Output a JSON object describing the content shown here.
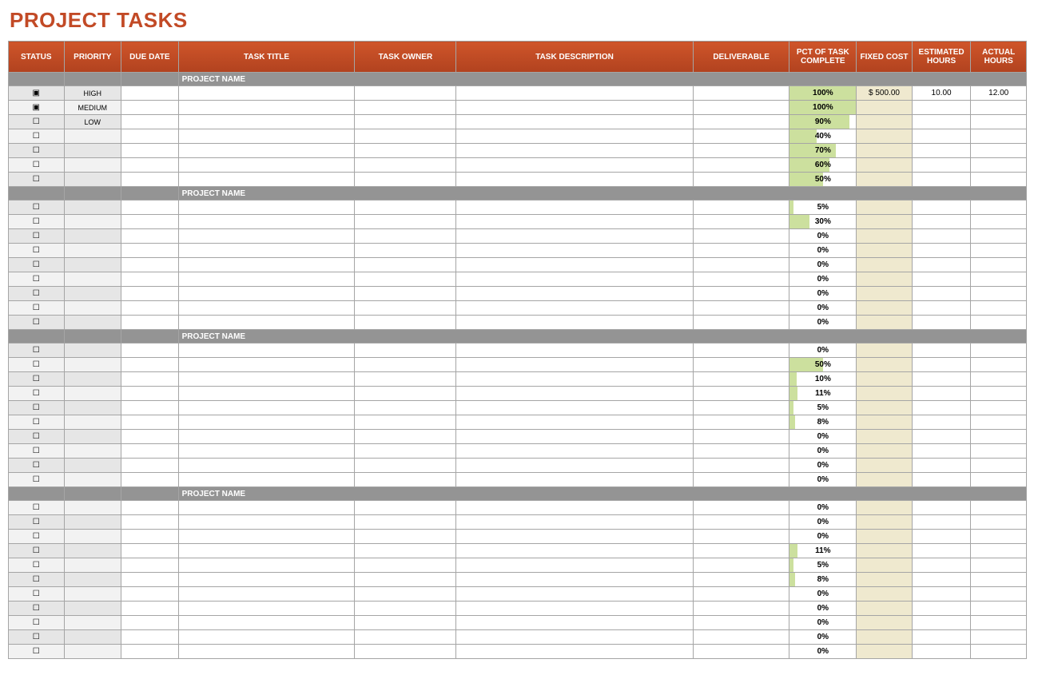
{
  "title": "PROJECT TASKS",
  "columns": [
    "STATUS",
    "PRIORITY",
    "DUE DATE",
    "TASK TITLE",
    "TASK OWNER",
    "TASK DESCRIPTION",
    "DELIVERABLE",
    "PCT OF TASK COMPLETE",
    "FIXED COST",
    "ESTIMATED HOURS",
    "ACTUAL HOURS"
  ],
  "section_label": "PROJECT NAME",
  "checkbox": {
    "checked": "▣",
    "unchecked": "☐"
  },
  "sections": [
    {
      "rows": [
        {
          "status": true,
          "priority": "HIGH",
          "pct": 100,
          "fixed_cost": "$      500.00",
          "est": "10.00",
          "act": "12.00"
        },
        {
          "status": true,
          "priority": "MEDIUM",
          "pct": 100
        },
        {
          "status": false,
          "priority": "LOW",
          "pct": 90
        },
        {
          "status": false,
          "pct": 40
        },
        {
          "status": false,
          "pct": 70
        },
        {
          "status": false,
          "pct": 60
        },
        {
          "status": false,
          "pct": 50
        }
      ]
    },
    {
      "rows": [
        {
          "status": false,
          "pct": 5
        },
        {
          "status": false,
          "pct": 30
        },
        {
          "status": false,
          "pct": 0
        },
        {
          "status": false,
          "pct": 0
        },
        {
          "status": false,
          "pct": 0
        },
        {
          "status": false,
          "pct": 0
        },
        {
          "status": false,
          "pct": 0
        },
        {
          "status": false,
          "pct": 0
        },
        {
          "status": false,
          "pct": 0
        }
      ]
    },
    {
      "rows": [
        {
          "status": false,
          "pct": 0
        },
        {
          "status": false,
          "pct": 50
        },
        {
          "status": false,
          "pct": 10
        },
        {
          "status": false,
          "pct": 11
        },
        {
          "status": false,
          "pct": 5
        },
        {
          "status": false,
          "pct": 8
        },
        {
          "status": false,
          "pct": 0
        },
        {
          "status": false,
          "pct": 0
        },
        {
          "status": false,
          "pct": 0
        },
        {
          "status": false,
          "pct": 0
        }
      ]
    },
    {
      "rows": [
        {
          "status": false,
          "pct": 0
        },
        {
          "status": false,
          "pct": 0
        },
        {
          "status": false,
          "pct": 0
        },
        {
          "status": false,
          "pct": 11
        },
        {
          "status": false,
          "pct": 5
        },
        {
          "status": false,
          "pct": 8
        },
        {
          "status": false,
          "pct": 0
        },
        {
          "status": false,
          "pct": 0
        },
        {
          "status": false,
          "pct": 0
        },
        {
          "status": false,
          "pct": 0
        },
        {
          "status": false,
          "pct": 0
        }
      ]
    }
  ]
}
